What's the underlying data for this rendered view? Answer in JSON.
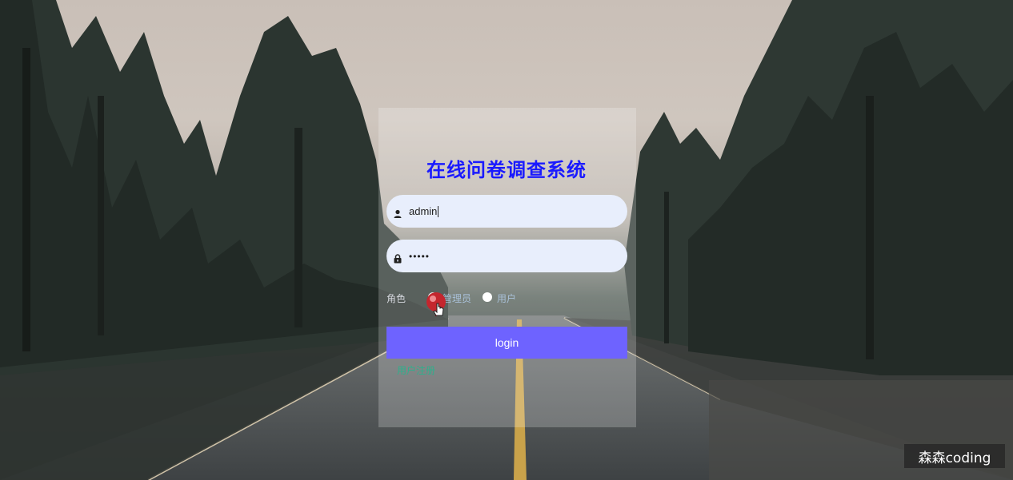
{
  "app": {
    "title": "在线问卷调查系统"
  },
  "login_form": {
    "username": {
      "icon": "user-icon",
      "value": "admin"
    },
    "password": {
      "icon": "lock-icon",
      "value": "•••••"
    },
    "role": {
      "label": "角色",
      "options": [
        "管理员",
        "用户"
      ],
      "selected": "管理员"
    },
    "submit_label": "login",
    "register_link": "用户注册"
  },
  "watermark": "森森coding",
  "colors": {
    "title": "#1a1aff",
    "button": "#6e63ff",
    "field_bg": "#e8eefc",
    "register_link": "#1fb88e"
  }
}
